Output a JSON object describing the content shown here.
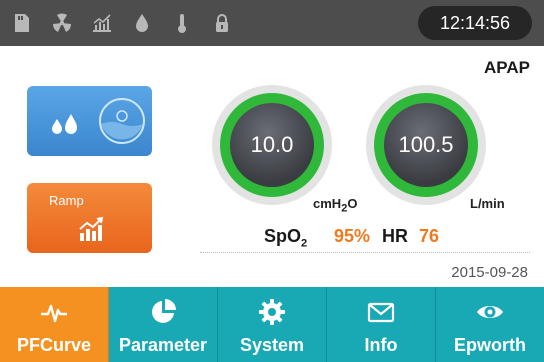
{
  "status_bar": {
    "icons": [
      "sd-card-icon",
      "radiation-icon",
      "signal-chart-icon",
      "water-drop-icon",
      "thermometer-icon",
      "lock-icon"
    ],
    "time": "12:14:56"
  },
  "mode": "APAP",
  "tiles": {
    "humidifier": {
      "icon": "humidifier-icon"
    },
    "ramp": {
      "label": "Ramp",
      "icon": "ramp-chart-icon"
    }
  },
  "gauges": {
    "pressure": {
      "value": "10.0",
      "unit_base": "cmH",
      "unit_sub": "2",
      "unit_tail": "O"
    },
    "flow": {
      "value": "100.5",
      "unit": "L/min"
    }
  },
  "vitals": {
    "spo2_label_base": "SpO",
    "spo2_label_sub": "2",
    "spo2_value": "95%",
    "hr_label": "HR",
    "hr_value": "76"
  },
  "date": "2015-09-28",
  "nav": {
    "items": [
      {
        "label": "PFCurve",
        "icon": "waveform-icon",
        "active": true
      },
      {
        "label": "Parameter",
        "icon": "pie-chart-icon",
        "active": false
      },
      {
        "label": "System",
        "icon": "gear-icon",
        "active": false
      },
      {
        "label": "Info",
        "icon": "envelope-icon",
        "active": false
      },
      {
        "label": "Epworth",
        "icon": "eye-icon",
        "active": false
      }
    ]
  },
  "colors": {
    "status_bar": "#4d4d4d",
    "accent_orange": "#f59121",
    "nav_teal": "#18a9b4",
    "gauge_green": "#2fb83a",
    "vital_value": "#f07a1e",
    "humid_tile": "#3b86cf"
  }
}
